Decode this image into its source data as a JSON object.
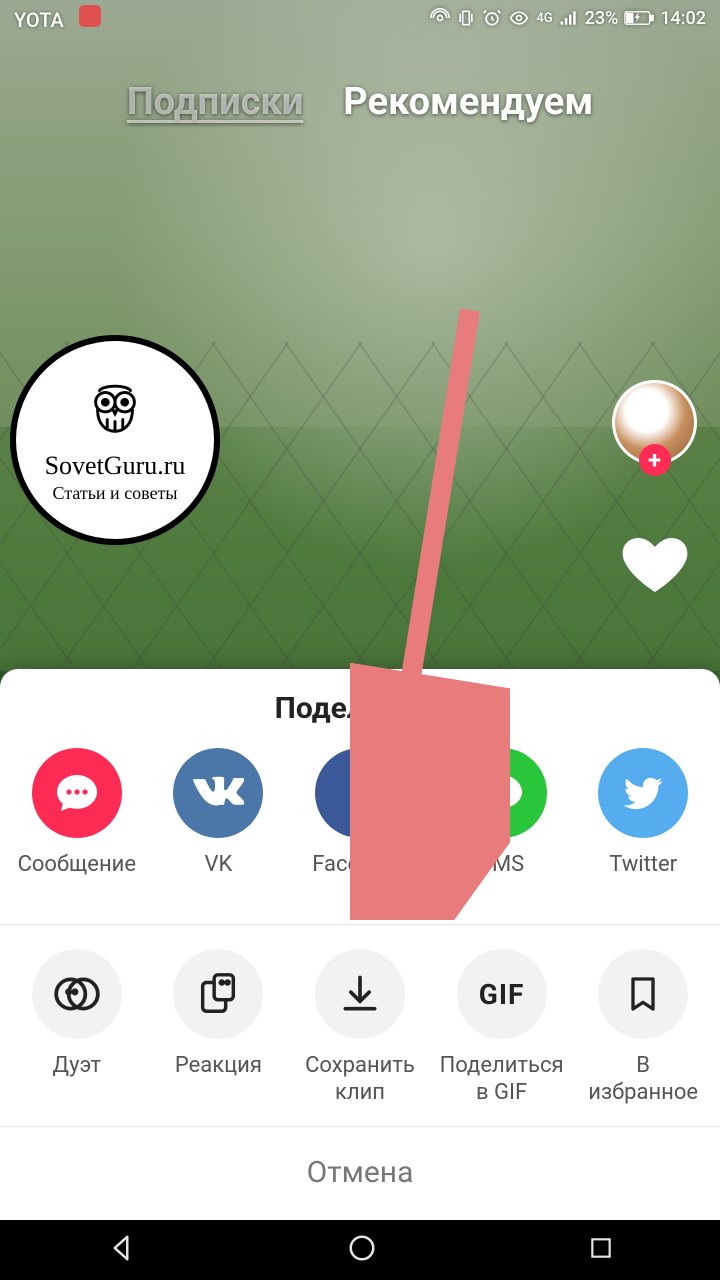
{
  "status": {
    "carrier": "YOTA",
    "network": "4G",
    "battery": "23%",
    "time": "14:02"
  },
  "tabs": {
    "following": "Подписки",
    "for_you": "Рекомендуем"
  },
  "watermark": {
    "line1": "SovetGuru.ru",
    "line2": "Статьи и советы"
  },
  "sheet": {
    "title": "Поделиться",
    "cancel": "Отмена"
  },
  "share_targets": {
    "message": "Сообщение",
    "vk": "VK",
    "facebook": "Facebook",
    "sms": "SMS",
    "twitter": "Twitter"
  },
  "actions": {
    "duet": "Дуэт",
    "react": "Реакция",
    "save": "Сохранить\nклип",
    "gif_label": "Поделиться\nв GIF",
    "gif_icon": "GIF",
    "favorite": "В\nизбранное"
  }
}
